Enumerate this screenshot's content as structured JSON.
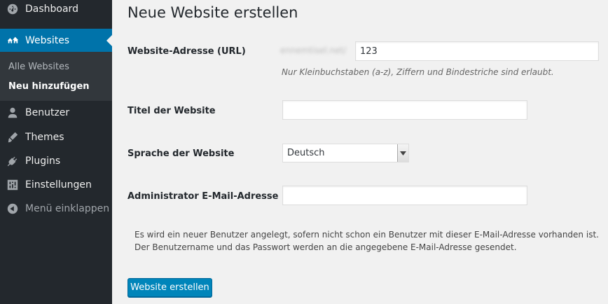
{
  "sidebar": {
    "items": [
      {
        "label": "Dashboard",
        "icon": "dashboard-icon"
      },
      {
        "label": "Websites",
        "icon": "websites-icon"
      },
      {
        "label": "Benutzer",
        "icon": "user-icon"
      },
      {
        "label": "Themes",
        "icon": "brush-icon"
      },
      {
        "label": "Plugins",
        "icon": "plugin-icon"
      },
      {
        "label": "Einstellungen",
        "icon": "settings-icon"
      },
      {
        "label": "Menü einklappen",
        "icon": "collapse-icon"
      }
    ],
    "submenu": [
      {
        "label": "Alle Websites"
      },
      {
        "label": "Neu hinzufügen"
      }
    ]
  },
  "page": {
    "title": "Neue Website erstellen",
    "url_label": "Website-Adresse (URL)",
    "url_prefix": "ennemtisel.net/",
    "url_value": "123",
    "url_help": "Nur Kleinbuchstaben (a-z), Ziffern und Bindestriche sind erlaubt.",
    "title_label": "Titel der Website",
    "title_value": "",
    "language_label": "Sprache der Website",
    "language_value": "Deutsch",
    "email_label": "Administrator E-Mail-Adresse",
    "email_value": "",
    "info_line1": "Es wird ein neuer Benutzer angelegt, sofern nicht schon ein Benutzer mit dieser E-Mail-Adresse vorhanden ist.",
    "info_line2": "Der Benutzername und das Passwort werden an die angegebene E-Mail-Adresse gesendet.",
    "submit_label": "Website erstellen"
  },
  "colors": {
    "sidebar_bg": "#23282d",
    "active_bg": "#0073aa",
    "button_bg": "#0085ba"
  }
}
